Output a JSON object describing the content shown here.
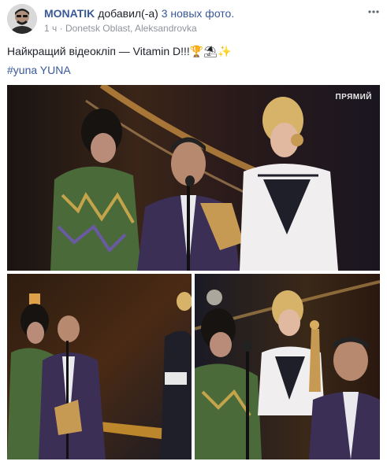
{
  "post": {
    "author": "MONATIK",
    "action": "добавил(-а)",
    "photos_link": "3 новых фото.",
    "time": "1 ч",
    "location": "Donetsk Oblast, Aleksandrovka",
    "separator": "·",
    "more_icon": "more-horizontal-icon",
    "globe_icon": "globe-icon",
    "text": "Найкращий відеокліп — Vitamin D!!!",
    "emoji": "🏆⛱✨",
    "hashtag": "#yuna",
    "tagged_user": "YUNA"
  },
  "photos": [
    {
      "label": "photo-1",
      "badge": "ПРЯМИЙ"
    },
    {
      "label": "photo-2"
    },
    {
      "label": "photo-3"
    }
  ]
}
